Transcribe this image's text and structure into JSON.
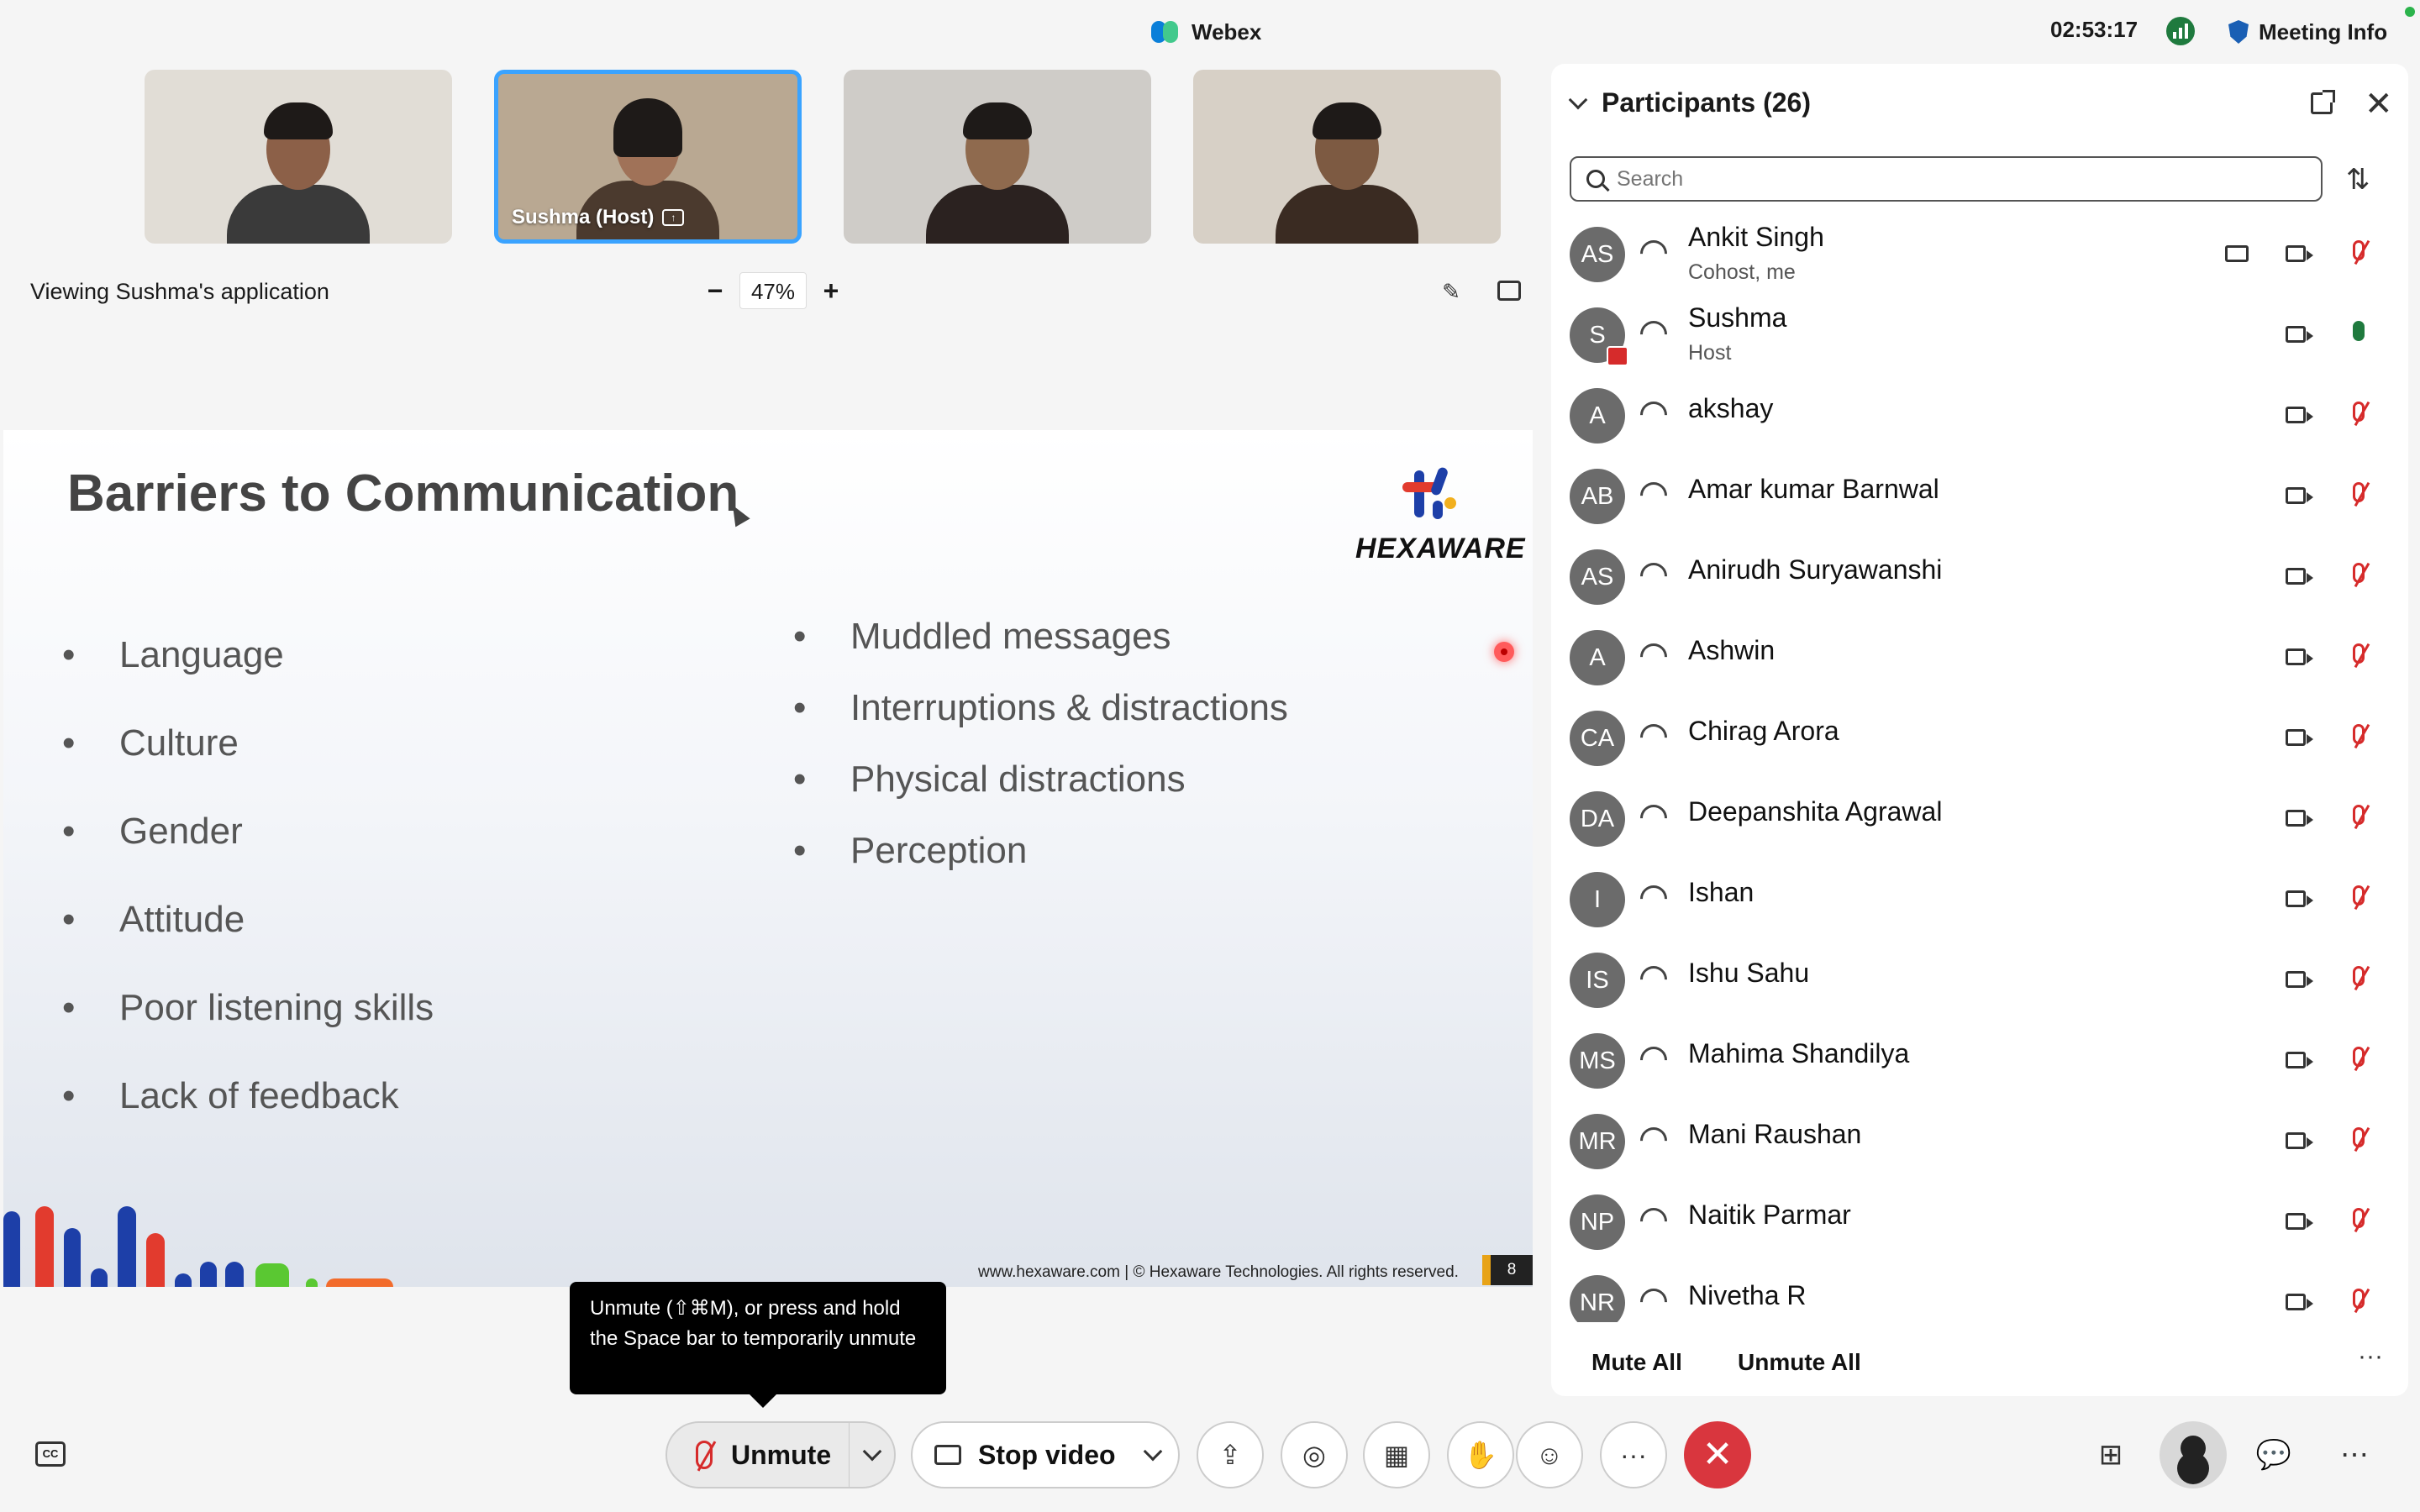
{
  "window": {
    "app_title": "Webex",
    "clock": "02:53:17",
    "meeting_info_label": "Meeting Info"
  },
  "thumbnails": [
    {
      "label": ""
    },
    {
      "label": "Sushma  (Host)"
    },
    {
      "label": ""
    },
    {
      "label": ""
    }
  ],
  "share_bar": {
    "viewing_text": "Viewing Sushma's application",
    "zoom_minus": "−",
    "zoom_value": "47%",
    "zoom_plus": "+"
  },
  "slide": {
    "title": "Barriers to Communication",
    "logo_text": "HEXAWARE",
    "left_bullets": [
      "Language",
      "Culture",
      "Gender",
      "Attitude",
      "Poor listening skills",
      "Lack of feedback"
    ],
    "right_bullets": [
      "Muddled messages",
      "Interruptions & distractions",
      "Physical distractions",
      "Perception"
    ],
    "footer": "www.hexaware.com  | © Hexaware Technologies. All rights reserved.",
    "page_number": "8"
  },
  "tooltip": {
    "text": "Unmute (⇧⌘M), or press and hold the Space bar to temporarily unmute"
  },
  "participants": {
    "title": "Participants (26)",
    "search_placeholder": "Search",
    "list": [
      {
        "initials": "AS",
        "name": "Ankit Singh",
        "role": "Cohost, me"
      },
      {
        "initials": "S",
        "name": "Sushma",
        "role": "Host"
      },
      {
        "initials": "A",
        "name": "akshay",
        "role": ""
      },
      {
        "initials": "AB",
        "name": "Amar kumar Barnwal",
        "role": ""
      },
      {
        "initials": "AS",
        "name": "Anirudh Suryawanshi",
        "role": ""
      },
      {
        "initials": "A",
        "name": "Ashwin",
        "role": ""
      },
      {
        "initials": "CA",
        "name": "Chirag Arora",
        "role": ""
      },
      {
        "initials": "DA",
        "name": "Deepanshita Agrawal",
        "role": ""
      },
      {
        "initials": "I",
        "name": "Ishan",
        "role": ""
      },
      {
        "initials": "IS",
        "name": "Ishu Sahu",
        "role": ""
      },
      {
        "initials": "MS",
        "name": "Mahima Shandilya",
        "role": ""
      },
      {
        "initials": "MR",
        "name": "Mani Raushan",
        "role": ""
      },
      {
        "initials": "NP",
        "name": "Naitik Parmar",
        "role": ""
      },
      {
        "initials": "NR",
        "name": "Nivetha R",
        "role": ""
      }
    ],
    "mute_all": "Mute All",
    "unmute_all": "Unmute All",
    "more": "···"
  },
  "controls": {
    "unmute_label": "Unmute",
    "video_label": "Stop video",
    "more": "···",
    "end": "✕"
  },
  "colors": {
    "accent": "#3aa3ff",
    "end_call": "#d9363e",
    "muted": "#d62b2b",
    "unmuted": "#1f7a3e"
  }
}
